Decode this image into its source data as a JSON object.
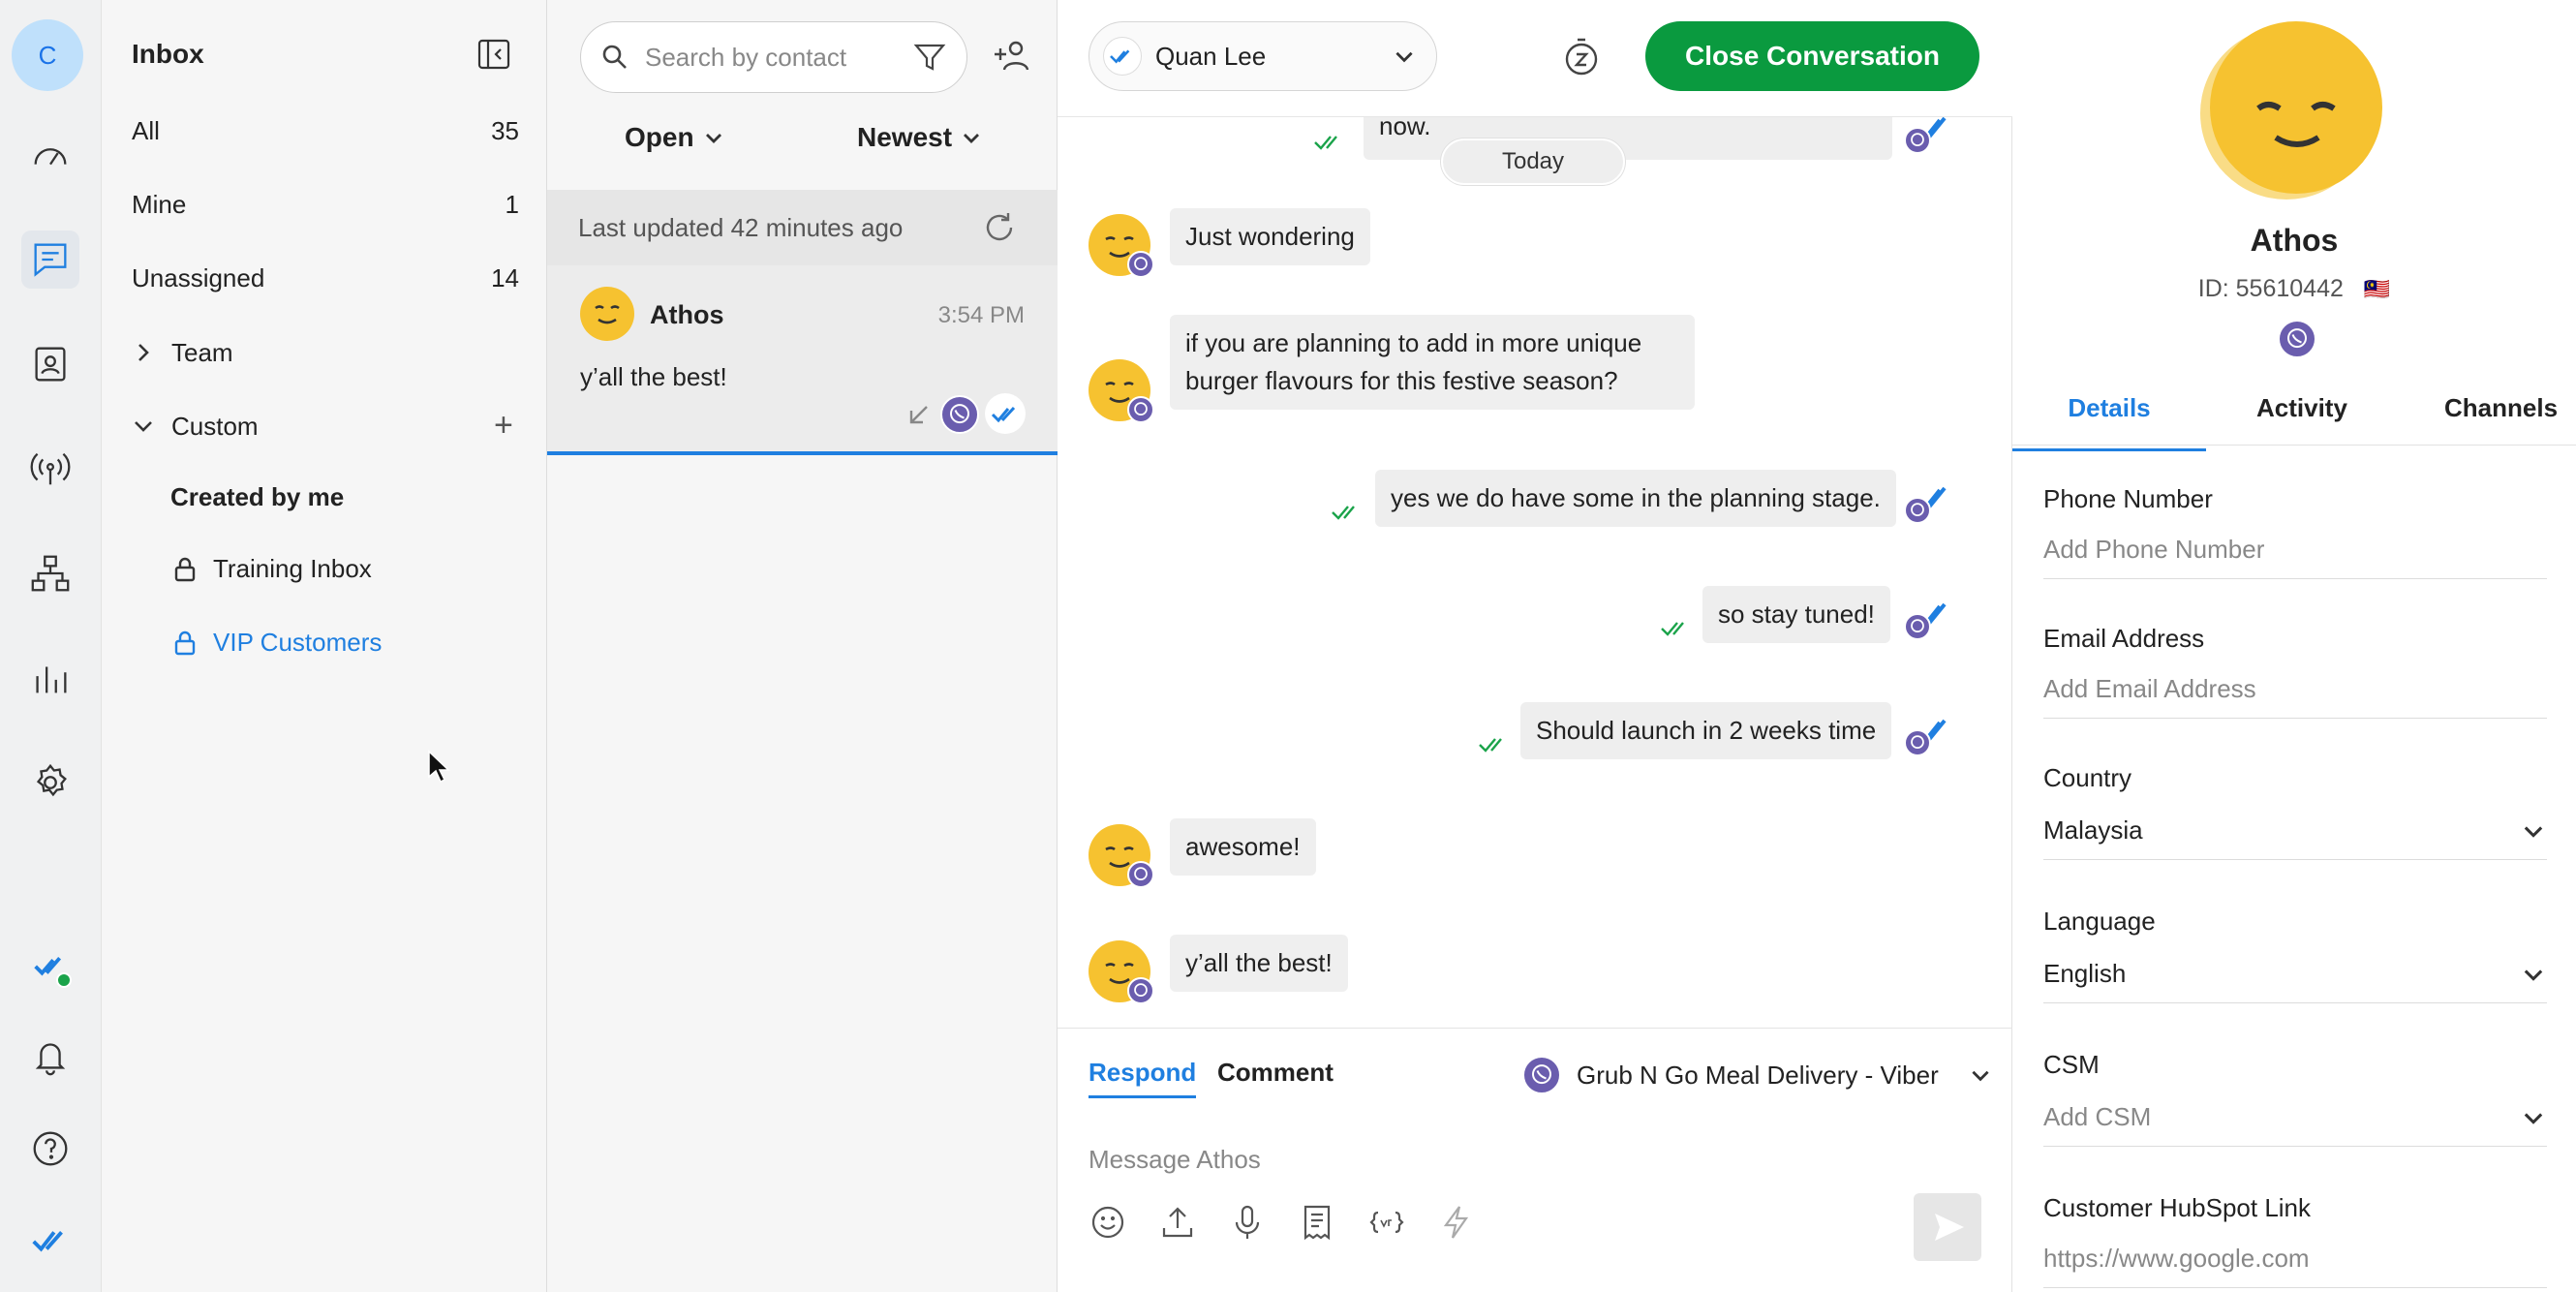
{
  "rail": {
    "avatar_letter": "C",
    "active": "conversations"
  },
  "inbox": {
    "title": "Inbox",
    "nav": [
      {
        "label": "All",
        "count": "35"
      },
      {
        "label": "Mine",
        "count": "1"
      },
      {
        "label": "Unassigned",
        "count": "14"
      }
    ],
    "team_label": "Team",
    "custom_label": "Custom",
    "custom_items": [
      "Created by me",
      "Training Inbox",
      "VIP Customers"
    ]
  },
  "conversation_list": {
    "search_placeholder": "Search by contact",
    "status_filter": "Open",
    "sort": "Newest",
    "last_updated": "Last updated 42 minutes ago",
    "item": {
      "name": "Athos",
      "time": "3:54 PM",
      "preview": "y’all the best!"
    }
  },
  "chat": {
    "assignee": "Quan Lee",
    "close_label": "Close Conversation",
    "partial_message": "now.",
    "date_divider": "Today",
    "messages": [
      {
        "dir": "in",
        "text": "Just wondering"
      },
      {
        "dir": "in",
        "text": "if you are planning to add in more unique burger flavours for this festive season?"
      },
      {
        "dir": "out",
        "text": "yes we do have some in the planning stage."
      },
      {
        "dir": "out",
        "text": "so stay tuned!"
      },
      {
        "dir": "out",
        "text": "Should launch in 2 weeks time"
      },
      {
        "dir": "in",
        "text": "awesome!"
      },
      {
        "dir": "in",
        "text": "y’all the best!"
      }
    ],
    "composer": {
      "tab_respond": "Respond",
      "tab_comment": "Comment",
      "channel": "Grub N Go Meal Delivery - Viber",
      "placeholder": "Message Athos"
    }
  },
  "contact": {
    "name": "Athos",
    "id_label": "ID: 55610442",
    "flag": "🇲🇾",
    "tabs": [
      "Details",
      "Activity",
      "Channels"
    ],
    "fields": [
      {
        "label": "Phone Number",
        "value": "Add Phone Number"
      },
      {
        "label": "Email Address",
        "value": "Add Email Address"
      },
      {
        "label": "Country",
        "value": "Malaysia"
      },
      {
        "label": "Language",
        "value": "English"
      },
      {
        "label": "CSM",
        "value": "Add CSM"
      },
      {
        "label": "Customer HubSpot Link",
        "value": "https://www.google.com"
      }
    ]
  },
  "colors": {
    "accent": "#1f7fe0",
    "close_button": "#0a9a3f",
    "viber": "#6a5dae",
    "avatar": "#f6c230"
  }
}
